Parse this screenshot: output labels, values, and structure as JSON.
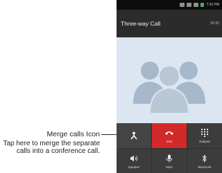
{
  "callout": {
    "title": "Merge calls Icon",
    "description": "Tap here to merge the separate calls into a conference call."
  },
  "statusbar": {
    "time": "7:30 PM",
    "icons": [
      "bluetooth-icon",
      "wifi-icon",
      "signal-icon",
      "battery-icon"
    ]
  },
  "call": {
    "title": "Three-way Call",
    "timer": "00:30"
  },
  "controls": [
    {
      "label": "",
      "icon": "merge-calls-icon"
    },
    {
      "label": "End",
      "icon": "end-call-icon"
    },
    {
      "label": "Dialpad",
      "icon": "dialpad-icon"
    },
    {
      "label": "Speaker",
      "icon": "speaker-icon"
    },
    {
      "label": "Mute",
      "icon": "mute-icon"
    },
    {
      "label": "Bluetooth",
      "icon": "bluetooth-icon"
    }
  ],
  "colors": {
    "end_button": "#d22a2a",
    "contact_background": "#dce6f0",
    "avatar": "#a6b8ca"
  }
}
